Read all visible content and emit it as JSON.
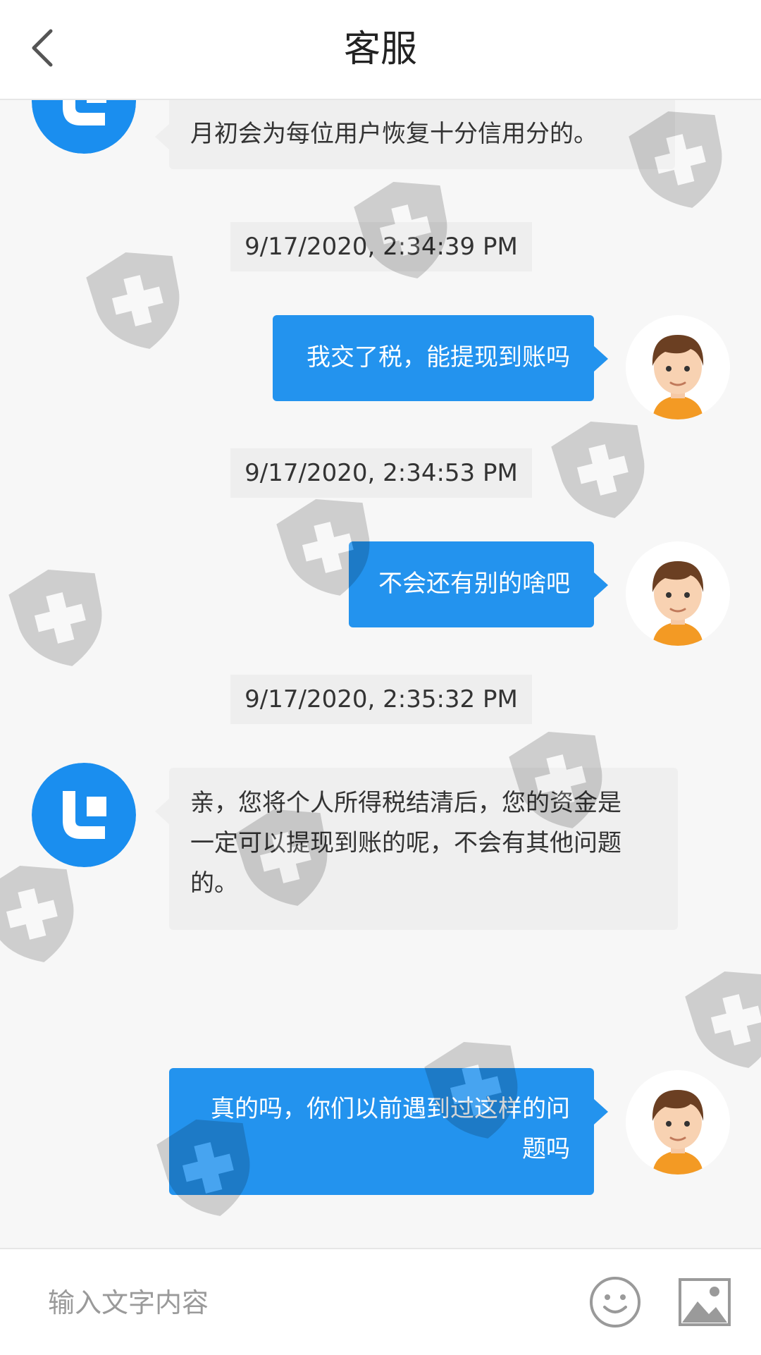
{
  "header": {
    "title": "客服",
    "back_icon": "chevron-left-icon"
  },
  "messages": [
    {
      "sender": "agent",
      "text": "月初会为每位用户恢复十分信用分的。"
    },
    {
      "timestamp": "9/17/2020, 2:34:39 PM"
    },
    {
      "sender": "user",
      "text": "我交了税，能提现到账吗"
    },
    {
      "timestamp": "9/17/2020, 2:34:53 PM"
    },
    {
      "sender": "user",
      "text": "不会还有别的啥吧"
    },
    {
      "timestamp": "9/17/2020, 2:35:32 PM"
    },
    {
      "sender": "agent",
      "lines": [
        "亲，您将个人所得税结清后，您的资金是",
        "一定可以提现到账的呢，不会有其他问题",
        "的。"
      ]
    },
    {
      "sender": "user",
      "lines": [
        "真的吗，你们以前遇到过这样的问",
        "题吗"
      ]
    }
  ],
  "input": {
    "placeholder": "输入文字内容",
    "value": ""
  },
  "icons": {
    "emoji": "smiley-icon",
    "image": "image-icon",
    "watermark": "shield-plus-icon"
  },
  "colors": {
    "accent": "#2393ee",
    "agent_bubble": "#efefef",
    "background": "#f7f7f7"
  }
}
